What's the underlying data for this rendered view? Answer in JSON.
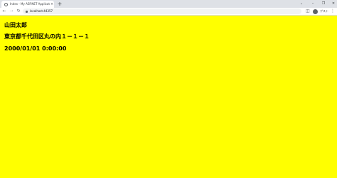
{
  "browser": {
    "tab_title": "Index - My ASP.NET Application",
    "tab_close": "×",
    "new_tab": "+",
    "window_controls": {
      "dropdown": "⌄",
      "minimize": "–",
      "maximize": "❐",
      "close": "✕"
    },
    "nav": {
      "back": "←",
      "forward": "→",
      "reload": "↻"
    },
    "url": "localhost:44357",
    "profile_label": "ゲスト",
    "menu": "⋮",
    "panel_icon": "◫"
  },
  "page": {
    "name": "山田太郎",
    "address": "東京都千代田区丸の内１－１－１",
    "datetime": "2000/01/01 0:00:00",
    "background": "#ffff00"
  }
}
